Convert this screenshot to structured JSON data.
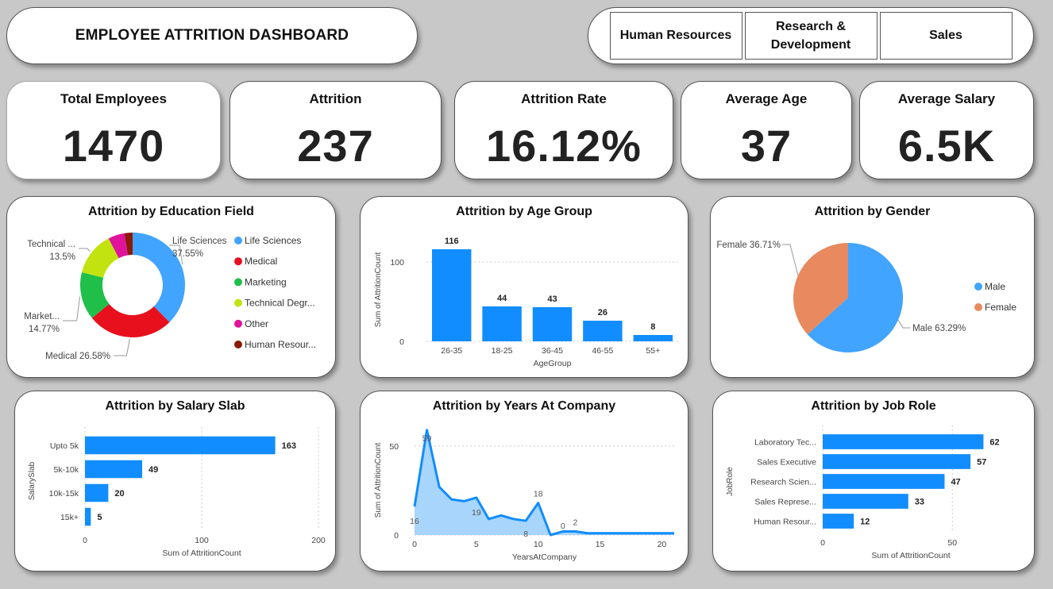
{
  "header": {
    "title": "EMPLOYEE ATTRITION DASHBOARD"
  },
  "filters": [
    {
      "label": "Human Resources"
    },
    {
      "label": "Research &\nDevelopment"
    },
    {
      "label": "Sales"
    }
  ],
  "kpis": [
    {
      "label": "Total Employees",
      "value": "1470"
    },
    {
      "label": "Attrition",
      "value": "237"
    },
    {
      "label": "Attrition Rate",
      "value": "16.12%"
    },
    {
      "label": "Average Age",
      "value": "37"
    },
    {
      "label": "Average Salary",
      "value": "6.5K"
    }
  ],
  "colors": {
    "blue": "#118dff",
    "salmon": "#e8895f",
    "pie_blue": "#41a4ff",
    "area_fill": "#9fd0fb"
  },
  "chart_data": [
    {
      "id": "education",
      "type": "pie",
      "title": "Attrition by Education Field",
      "donut": true,
      "slices": [
        {
          "name": "Life Sciences",
          "legend": "Life Sciences",
          "percent": 37.55,
          "label": "Life Sciences",
          "label_value": "37.55%",
          "color": "#41a4ff"
        },
        {
          "name": "Medical",
          "legend": "Medical",
          "percent": 26.58,
          "label": "Medical 26.58%",
          "label_value": "",
          "color": "#e8101d"
        },
        {
          "name": "Marketing",
          "legend": "Marketing",
          "percent": 14.77,
          "label": "Market...",
          "label_value": "14.77%",
          "color": "#1fbf4a"
        },
        {
          "name": "Technical Degree",
          "legend": "Technical Degr...",
          "percent": 13.5,
          "label": "Technical ...",
          "label_value": "13.5%",
          "color": "#c2e30f"
        },
        {
          "name": "Other",
          "legend": "Other",
          "percent": 5.06,
          "label": "",
          "label_value": "",
          "color": "#e0139d"
        },
        {
          "name": "Human Resources",
          "legend": "Human Resour...",
          "percent": 2.53,
          "label": "",
          "label_value": "",
          "color": "#8b1a08"
        }
      ]
    },
    {
      "id": "age",
      "type": "bar",
      "title": "Attrition by Age Group",
      "categories": [
        "26-35",
        "18-25",
        "36-45",
        "46-55",
        "55+"
      ],
      "values": [
        116,
        44,
        43,
        26,
        8
      ],
      "xlabel": "AgeGroup",
      "ylabel": "Sum of AttritionCount",
      "yticks": [
        0,
        100
      ],
      "ylim": [
        0,
        130
      ]
    },
    {
      "id": "gender",
      "type": "pie",
      "title": "Attrition by Gender",
      "slices": [
        {
          "name": "Male",
          "legend": "Male",
          "percent": 63.29,
          "label": "Male 63.29%",
          "color": "#41a4ff"
        },
        {
          "name": "Female",
          "legend": "Female",
          "percent": 36.71,
          "label": "Female 36.71%",
          "color": "#e8895f"
        }
      ]
    },
    {
      "id": "salary",
      "type": "bar",
      "orientation": "horizontal",
      "title": "Attrition by Salary Slab",
      "categories": [
        "Upto 5k",
        "5k-10k",
        "10k-15k",
        "15k+"
      ],
      "values": [
        163,
        49,
        20,
        5
      ],
      "xlabel": "Sum of AttritionCount",
      "ylabel": "SalarySlab",
      "xticks": [
        0,
        100,
        200
      ],
      "xlim": [
        0,
        200
      ]
    },
    {
      "id": "years",
      "type": "area",
      "title": "Attrition by Years At Company",
      "x": [
        0,
        1,
        2,
        3,
        4,
        5,
        6,
        7,
        8,
        9,
        10,
        11,
        12,
        13,
        14,
        15,
        16,
        17,
        18,
        19,
        20,
        21
      ],
      "values": [
        16,
        59,
        27,
        20,
        19,
        21,
        9,
        11,
        9,
        8,
        18,
        0,
        2,
        2,
        1,
        1,
        1,
        1,
        1,
        1,
        1,
        1
      ],
      "data_labels": [
        {
          "i": 0,
          "text": "16"
        },
        {
          "i": 1,
          "text": "59"
        },
        {
          "i": 5,
          "text": "19"
        },
        {
          "i": 9,
          "text": "8"
        },
        {
          "i": 10,
          "text": "18"
        },
        {
          "i": 12,
          "text": "0"
        },
        {
          "i": 13,
          "text": "2"
        }
      ],
      "xlabel": "YearsAtCompany",
      "ylabel": "Sum of AttritionCount",
      "xticks": [
        0,
        5,
        10,
        15,
        20
      ],
      "yticks": [
        0,
        50
      ],
      "xlim": [
        0,
        21
      ],
      "ylim": [
        0,
        62
      ]
    },
    {
      "id": "jobrole",
      "type": "bar",
      "orientation": "horizontal",
      "title": "Attrition by Job Role",
      "categories": [
        "Laboratory Tec...",
        "Sales Executive",
        "Research Scien...",
        "Sales Represe...",
        "Human Resour..."
      ],
      "values": [
        62,
        57,
        47,
        33,
        12
      ],
      "xlabel": "Sum of AttritionCount",
      "ylabel": "JobRole",
      "xticks": [
        0,
        50
      ],
      "xlim": [
        0,
        68
      ]
    }
  ]
}
